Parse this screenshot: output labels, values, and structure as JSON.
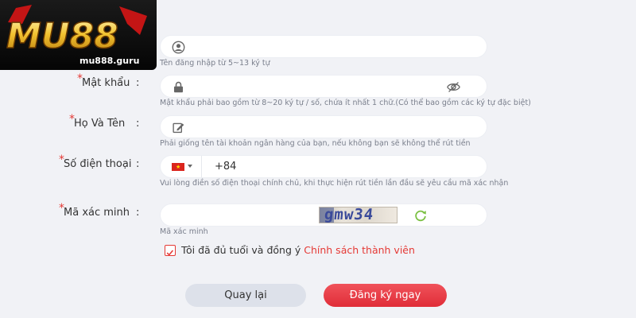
{
  "brand": {
    "logo_text": "MU88",
    "site": "mu888.guru"
  },
  "username": {
    "hint": "Tên đăng nhập từ 5~13 ký tự"
  },
  "password": {
    "label": "Mật khẩu",
    "required_mark": "*",
    "hint": "Mật khẩu phải bao gồm từ 8~20 ký tự / số, chứa ít nhất 1 chữ.(Có thể bao gồm các ký tự đặc biệt)"
  },
  "fullname": {
    "label": "Họ Và Tên",
    "required_mark": "*",
    "hint": "Phải giống tên tài khoản ngân hàng của bạn, nếu không bạn sẽ không thể rút tiền"
  },
  "phone": {
    "label": "Số điện thoại",
    "required_mark": "*",
    "country_code": "+84",
    "hint": "Vui lòng điền số điện thoại chính chủ, khi thực hiện rút tiền lần đầu sẽ yêu cầu mã xác nhận"
  },
  "captcha": {
    "label": "Mã xác minh",
    "required_mark": "*",
    "image_text": "gmw34",
    "hint": "Mã xác minh"
  },
  "colon": ":",
  "agreement": {
    "text": "Tôi đã đủ tuổi và đồng ý ",
    "link": "Chính sách thành viên"
  },
  "buttons": {
    "back": "Quay lại",
    "submit": "Đăng ký ngay"
  },
  "colors": {
    "accent": "#e53935",
    "background": "#f1f2f6",
    "icon": "#666666"
  }
}
